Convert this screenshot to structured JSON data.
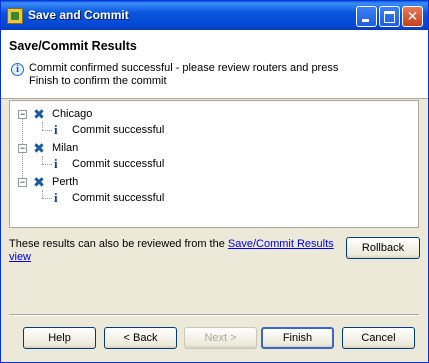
{
  "window": {
    "title": "Save and Commit"
  },
  "header": {
    "title": "Save/Commit Results",
    "message": "Commit confirmed successful - please review routers and press Finish to confirm the commit"
  },
  "tree": {
    "routers": [
      {
        "name": "Chicago",
        "status": "Commit successful"
      },
      {
        "name": "Milan",
        "status": "Commit successful"
      },
      {
        "name": "Perth",
        "status": "Commit successful"
      }
    ]
  },
  "footer": {
    "note_prefix": "These results can also be reviewed from the ",
    "link_text": "Save/Commit Results view",
    "rollback_label": "Rollback",
    "help_label": "Help",
    "back_label": "< Back",
    "next_label": "Next >",
    "finish_label": "Finish",
    "cancel_label": "Cancel"
  }
}
